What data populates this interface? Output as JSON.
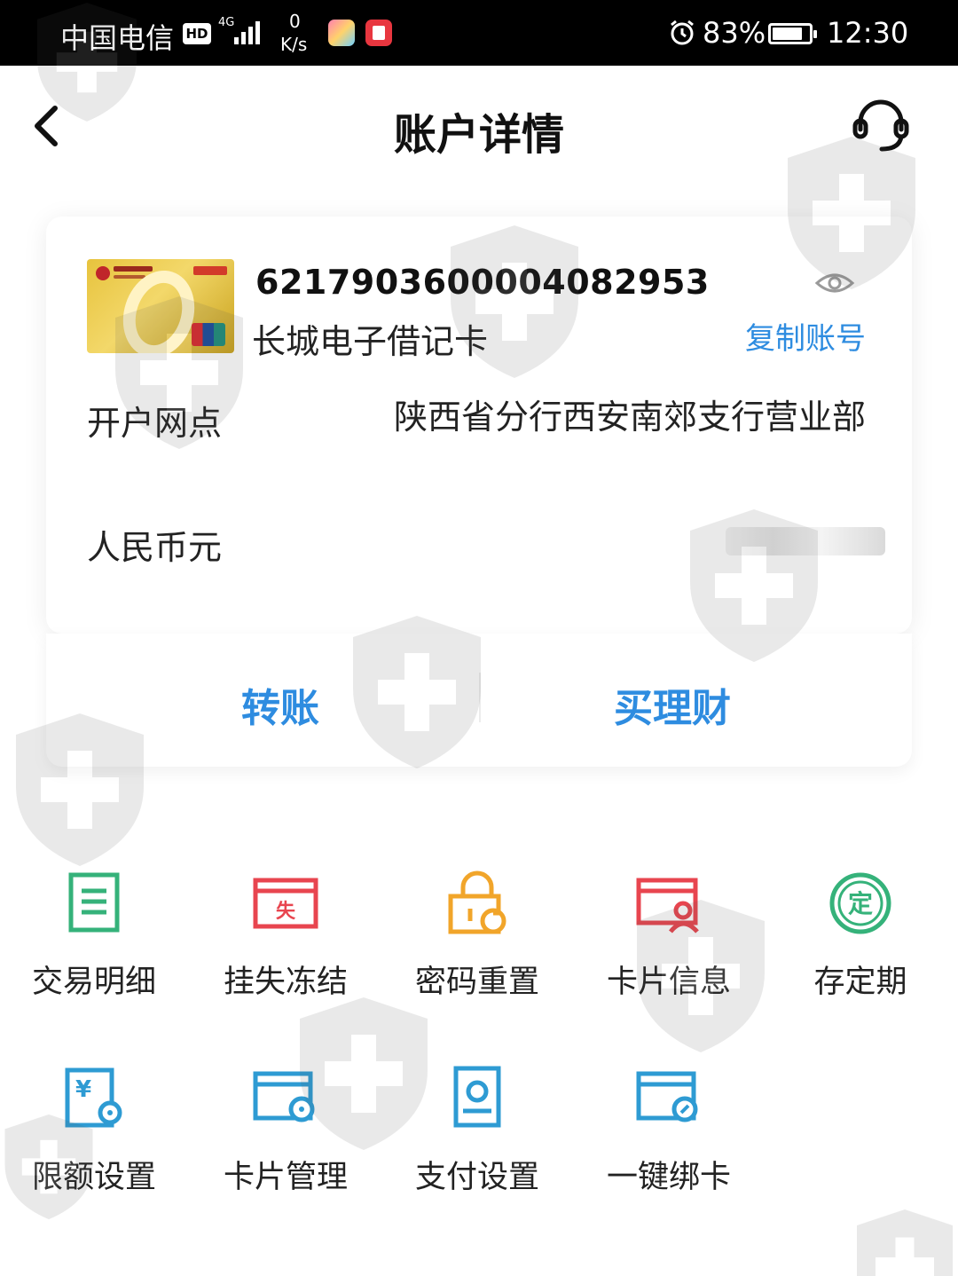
{
  "status_bar": {
    "carrier": "中国电信",
    "hd_badge": "HD",
    "network": "4G",
    "speed_value": "0",
    "speed_unit": "K/s",
    "battery": "83%",
    "battery_level": 0.83,
    "time": "12:30"
  },
  "header": {
    "title": "账户详情"
  },
  "account": {
    "number": "6217903600004082953",
    "card_type": "长城电子借记卡",
    "copy_label": "复制账号",
    "branch_label": "开户网点",
    "branch_value": "陕西省分行西安南郊支行营业部",
    "currency_label": "人民币元"
  },
  "actions": {
    "transfer": "转账",
    "wealth": "买理财"
  },
  "colors": {
    "accent_blue": "#2e8ce0",
    "green": "#35b27a",
    "red": "#e8454f",
    "orange": "#f1a52a",
    "teal": "#2e9bd3"
  },
  "menu": [
    {
      "label": "交易明细",
      "icon": "document-list-icon"
    },
    {
      "label": "挂失冻结",
      "icon": "loss-card-icon"
    },
    {
      "label": "密码重置",
      "icon": "lock-reset-icon"
    },
    {
      "label": "卡片信息",
      "icon": "card-user-icon"
    },
    {
      "label": "存定期",
      "icon": "fixed-deposit-icon"
    },
    {
      "label": "限额设置",
      "icon": "limit-settings-icon"
    },
    {
      "label": "卡片管理",
      "icon": "card-settings-icon"
    },
    {
      "label": "支付设置",
      "icon": "payment-settings-icon"
    },
    {
      "label": "一键绑卡",
      "icon": "bind-card-icon"
    }
  ]
}
